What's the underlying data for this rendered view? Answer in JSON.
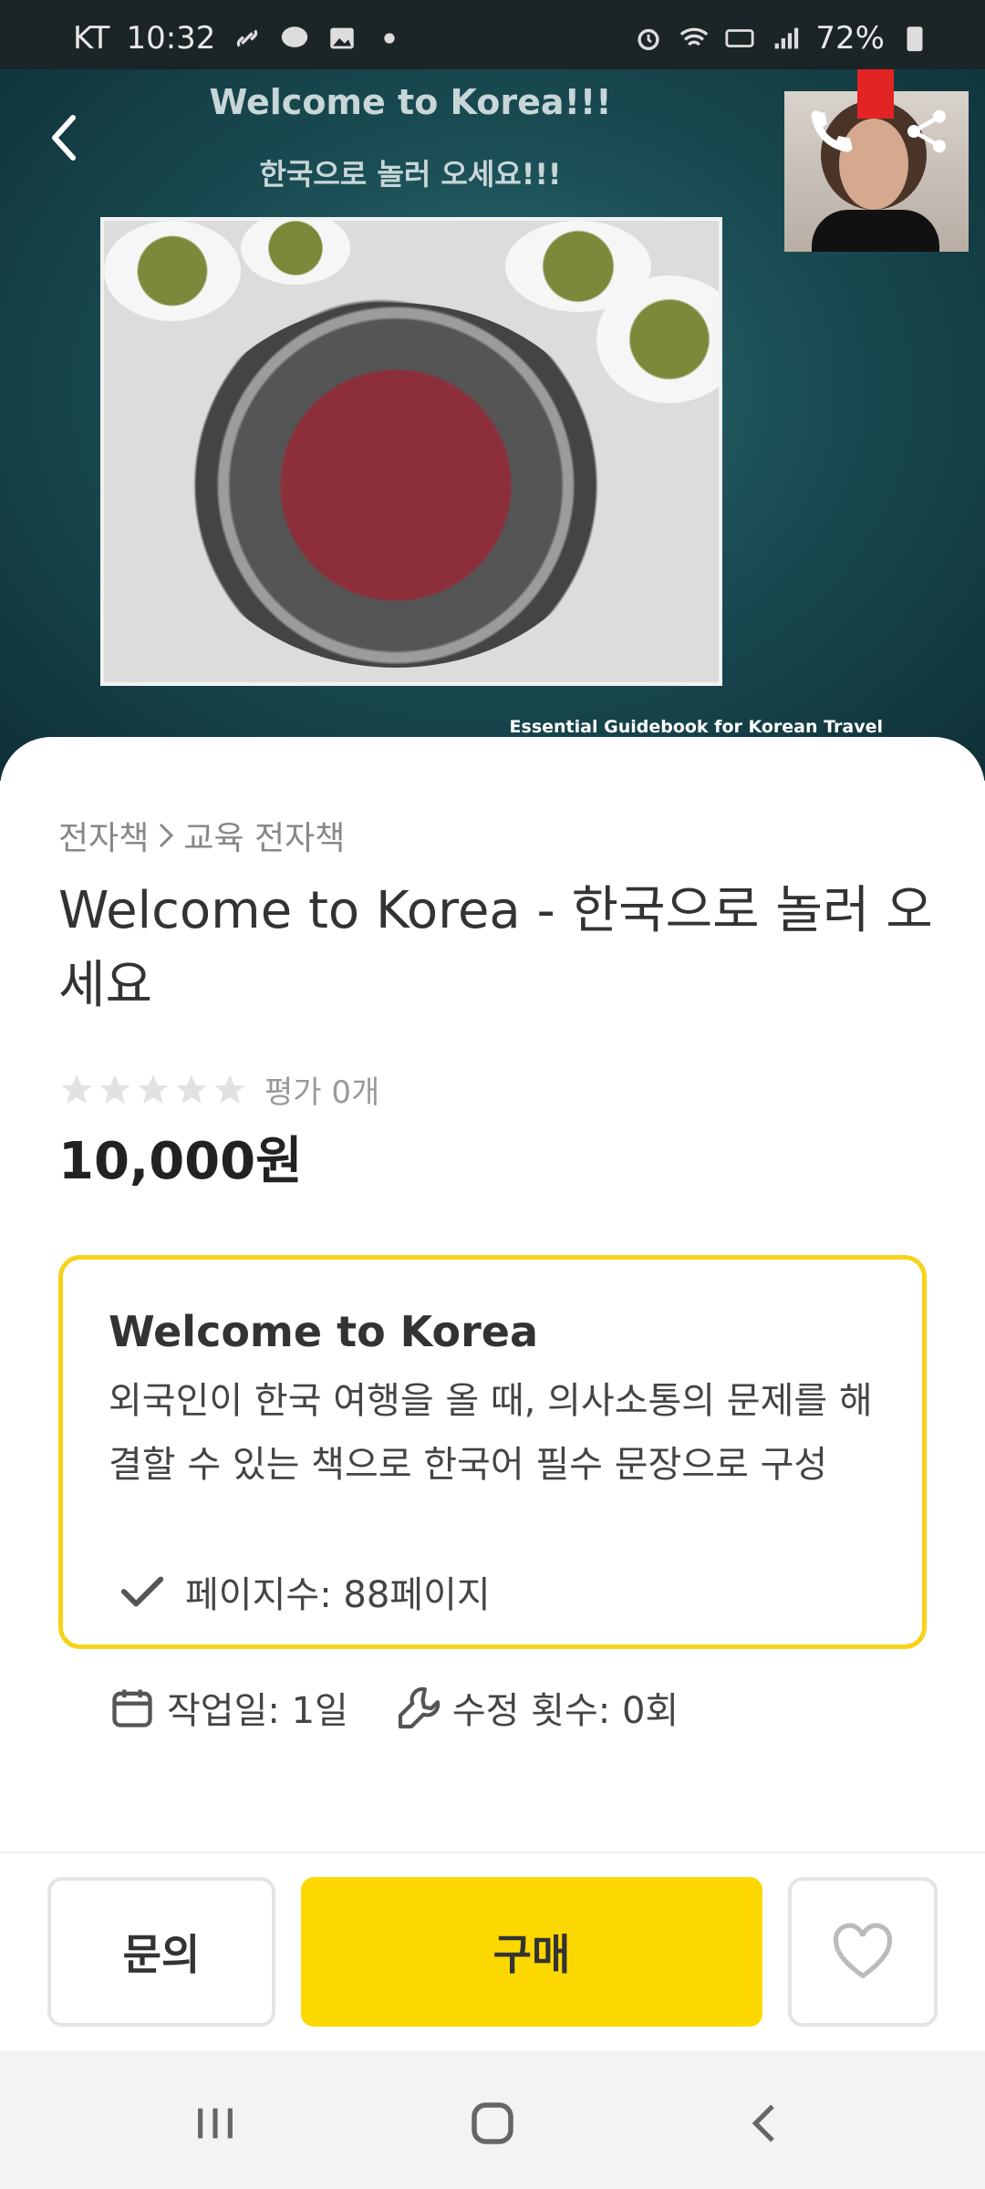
{
  "status_bar": {
    "carrier": "KT",
    "time": "10:32",
    "battery": "72%"
  },
  "hero": {
    "title": "Welcome to Korea!!!",
    "subtitle": "한국으로 놀러 오세요!!!",
    "caption": "Essential Guidebook for Korean Travel"
  },
  "product": {
    "breadcrumb": [
      "전자책",
      "교육 전자책"
    ],
    "title": "Welcome to Korea - 한국으로 놀러 오세요",
    "rating_value": 0,
    "rating_text": "평가 0개",
    "price": "10,000원"
  },
  "info": {
    "title": "Welcome to Korea",
    "description": "외국인이 한국 여행을 올 때, 의사소통의 문제를 해결할 수 있는 책으로 한국어 필수 문장으로 구성",
    "pages": "페이지수: 88페이지",
    "work_days": "작업일: 1일",
    "revisions": "수정 횟수: 0회"
  },
  "actions": {
    "inquiry": "문의",
    "buy": "구매"
  },
  "colors": {
    "accent": "#fdd800",
    "border_accent": "#f7d21b"
  }
}
